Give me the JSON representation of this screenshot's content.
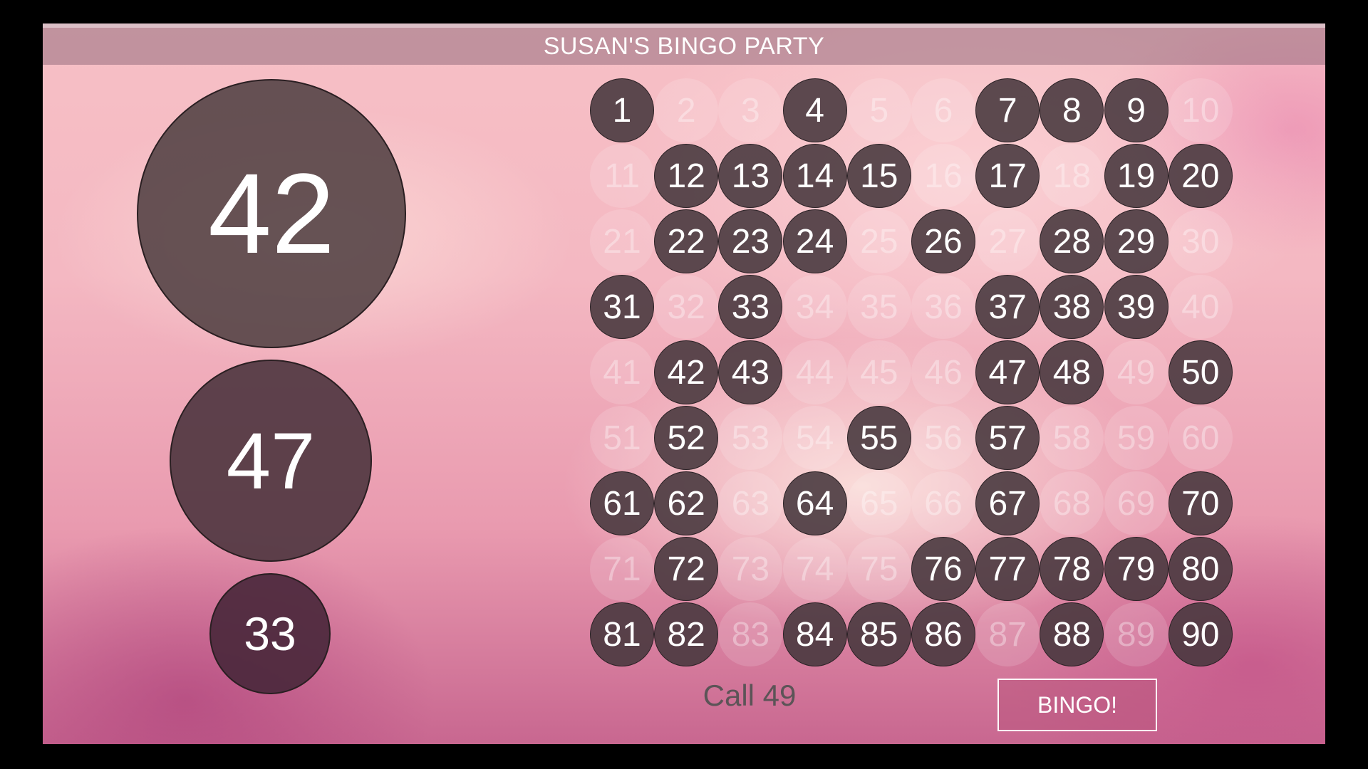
{
  "header": {
    "title": "SUSAN'S BINGO PARTY"
  },
  "recent_calls": {
    "current": "42",
    "previous_1": "47",
    "previous_2": "33"
  },
  "board": {
    "numbers": [
      1,
      2,
      3,
      4,
      5,
      6,
      7,
      8,
      9,
      10,
      11,
      12,
      13,
      14,
      15,
      16,
      17,
      18,
      19,
      20,
      21,
      22,
      23,
      24,
      25,
      26,
      27,
      28,
      29,
      30,
      31,
      32,
      33,
      34,
      35,
      36,
      37,
      38,
      39,
      40,
      41,
      42,
      43,
      44,
      45,
      46,
      47,
      48,
      49,
      50,
      51,
      52,
      53,
      54,
      55,
      56,
      57,
      58,
      59,
      60,
      61,
      62,
      63,
      64,
      65,
      66,
      67,
      68,
      69,
      70,
      71,
      72,
      73,
      74,
      75,
      76,
      77,
      78,
      79,
      80,
      81,
      82,
      83,
      84,
      85,
      86,
      87,
      88,
      89,
      90
    ],
    "called": [
      1,
      4,
      7,
      8,
      9,
      12,
      13,
      14,
      15,
      17,
      19,
      20,
      22,
      23,
      24,
      26,
      28,
      29,
      31,
      33,
      37,
      38,
      39,
      42,
      43,
      47,
      48,
      50,
      52,
      55,
      57,
      61,
      62,
      64,
      67,
      70,
      72,
      76,
      77,
      78,
      79,
      80,
      81,
      82,
      84,
      85,
      86,
      88,
      90
    ]
  },
  "footer": {
    "call_text": "Call 49",
    "bingo_label": "BINGO!"
  },
  "colors": {
    "called_ball": "#463a3d",
    "uncalled_ball": "#ffffff",
    "accent": "#b9557d"
  }
}
